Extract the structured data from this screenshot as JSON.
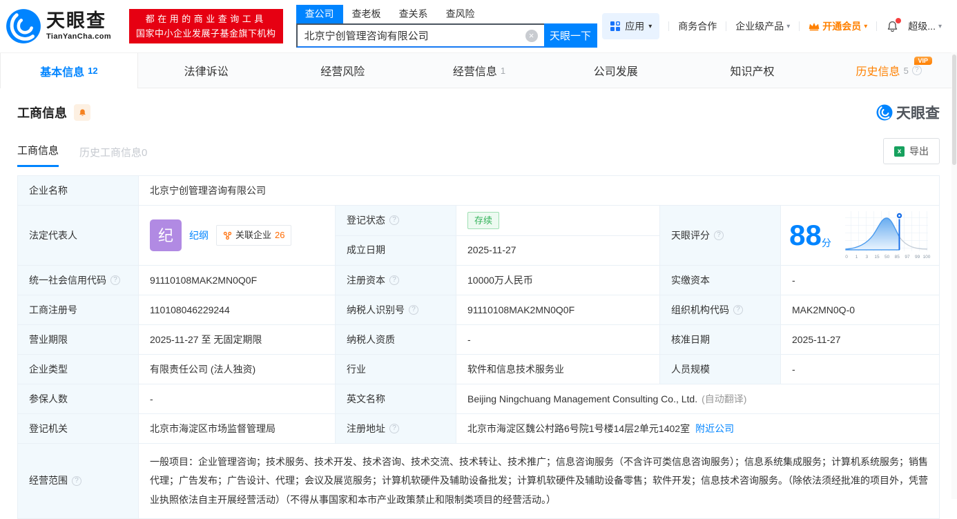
{
  "colors": {
    "brand_blue": "#0084ff",
    "vip_orange": "#ff8000",
    "promo_red": "#e60012",
    "status_green": "#34b35a",
    "avatar_purple": "#b18ae3"
  },
  "icons": {
    "caret": "▾",
    "clear": "×",
    "help": "?",
    "excel": "x"
  },
  "header": {
    "logo": {
      "name": "天眼查",
      "domain": "TianYanCha.com"
    },
    "promo": {
      "line1": "都在用的商业查询工具",
      "line2": "国家中小企业发展子基金旗下机构"
    },
    "search": {
      "tabs": [
        "查公司",
        "查老板",
        "查关系",
        "查风险"
      ],
      "value": "北京宁创管理咨询有限公司",
      "button": "天眼一下"
    },
    "nav": {
      "apps": "应用",
      "cooperation": "商务合作",
      "enterprise": "企业级产品",
      "membership": "开通会员",
      "account": "超级..."
    }
  },
  "tabs": [
    {
      "label": "基本信息",
      "count": "12"
    },
    {
      "label": "法律诉讼"
    },
    {
      "label": "经营风险"
    },
    {
      "label": "经营信息",
      "count": "1"
    },
    {
      "label": "公司发展"
    },
    {
      "label": "知识产权"
    },
    {
      "label": "历史信息",
      "count": "5",
      "vip_badge": "VIP"
    }
  ],
  "section": {
    "title": "工商信息",
    "watermark": "天眼查",
    "subtabs": [
      {
        "label": "工商信息"
      },
      {
        "label": "历史工商信息0"
      }
    ],
    "export_label": "导出"
  },
  "table": {
    "company_name": {
      "label": "企业名称",
      "value": "北京宁创管理咨询有限公司"
    },
    "legal_rep": {
      "label": "法定代表人",
      "avatar": "纪",
      "name": "纪纲",
      "related_label": "关联企业",
      "related_count": "26"
    },
    "reg_status": {
      "label": "登记状态",
      "value": "存续"
    },
    "establish_date": {
      "label": "成立日期",
      "value": "2025-11-27"
    },
    "score": {
      "label": "天眼评分",
      "value": "88",
      "unit": "分",
      "axis": [
        "0",
        "1",
        "3",
        "15",
        "50",
        "85",
        "97",
        "99",
        "100"
      ]
    },
    "credit_code": {
      "label": "统一社会信用代码",
      "value": "91110108MAK2MN0Q0F"
    },
    "reg_capital": {
      "label": "注册资本",
      "value": "10000万人民币"
    },
    "paid_capital": {
      "label": "实缴资本",
      "value": "-"
    },
    "reg_number": {
      "label": "工商注册号",
      "value": "110108046229244"
    },
    "taxpayer_id": {
      "label": "纳税人识别号",
      "value": "91110108MAK2MN0Q0F"
    },
    "org_code": {
      "label": "组织机构代码",
      "value": "MAK2MN0Q-0"
    },
    "business_term": {
      "label": "营业期限",
      "value": "2025-11-27 至 无固定期限"
    },
    "taxpayer_quality": {
      "label": "纳税人资质",
      "value": "-"
    },
    "approve_date": {
      "label": "核准日期",
      "value": "2025-11-27"
    },
    "company_type": {
      "label": "企业类型",
      "value": "有限责任公司 (法人独资)"
    },
    "industry": {
      "label": "行业",
      "value": "软件和信息技术服务业"
    },
    "staff_size": {
      "label": "人员规模",
      "value": "-"
    },
    "insured_count": {
      "label": "参保人数",
      "value": "-"
    },
    "english_name": {
      "label": "英文名称",
      "value": "Beijing Ningchuang Management Consulting Co., Ltd.",
      "note": "(自动翻译)"
    },
    "reg_authority": {
      "label": "登记机关",
      "value": "北京市海淀区市场监督管理局"
    },
    "reg_address": {
      "label": "注册地址",
      "value": "北京市海淀区魏公村路6号院1号楼14层2单元1402室",
      "link": "附近公司"
    },
    "business_scope": {
      "label": "经营范围",
      "value": "一般项目：企业管理咨询；技术服务、技术开发、技术咨询、技术交流、技术转让、技术推广；信息咨询服务（不含许可类信息咨询服务）；信息系统集成服务；计算机系统服务；销售代理；广告发布；广告设计、代理；会议及展览服务；计算机软硬件及辅助设备批发；计算机软硬件及辅助设备零售；软件开发；信息技术咨询服务。（除依法须经批准的项目外，凭营业执照依法自主开展经营活动）（不得从事国家和本市产业政策禁止和限制类项目的经营活动。）"
    }
  }
}
